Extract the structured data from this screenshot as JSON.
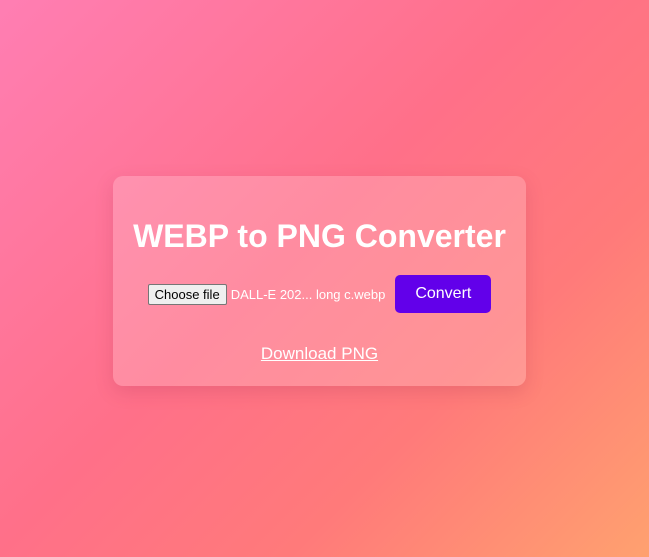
{
  "card": {
    "title": "WEBP to PNG Converter",
    "file_input": {
      "button_label": "Choose file",
      "file_name": "DALL-E 202... long c.webp"
    },
    "convert_label": "Convert",
    "download_label": "Download PNG"
  },
  "colors": {
    "convert_button": "#6200ea",
    "text": "#ffffff"
  }
}
